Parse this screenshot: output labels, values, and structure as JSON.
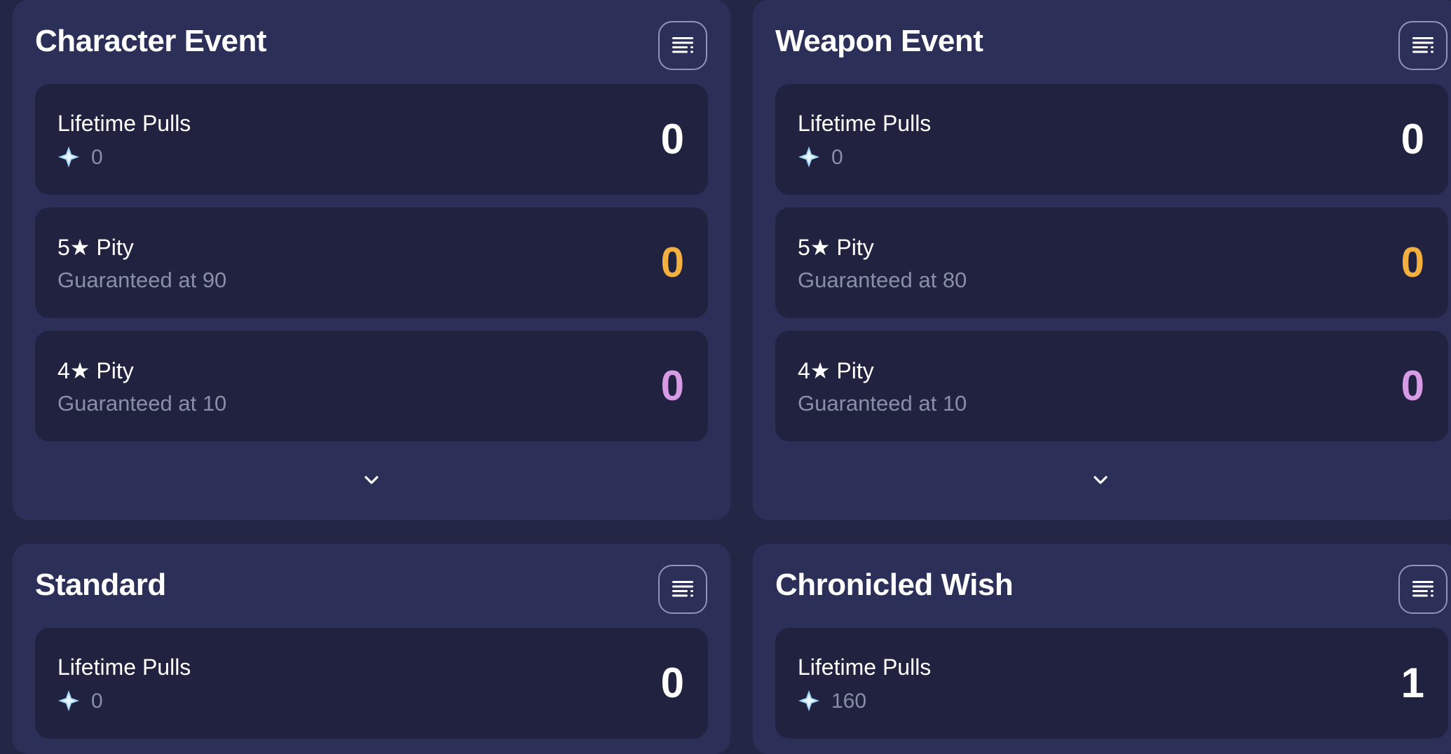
{
  "banners": [
    {
      "title": "Character Event",
      "lifetime_label": "Lifetime Pulls",
      "lifetime_value": "0",
      "primogems": "0",
      "five_star_label": "5★ Pity",
      "five_star_guarantee": "Guaranteed at 90",
      "five_star_value": "0",
      "four_star_label": "4★ Pity",
      "four_star_guarantee": "Guaranteed at 10",
      "four_star_value": "0"
    },
    {
      "title": "Weapon Event",
      "lifetime_label": "Lifetime Pulls",
      "lifetime_value": "0",
      "primogems": "0",
      "five_star_label": "5★ Pity",
      "five_star_guarantee": "Guaranteed at 80",
      "five_star_value": "0",
      "four_star_label": "4★ Pity",
      "four_star_guarantee": "Guaranteed at 10",
      "four_star_value": "0"
    },
    {
      "title": "Standard",
      "lifetime_label": "Lifetime Pulls",
      "lifetime_value": "0",
      "primogems": "0"
    },
    {
      "title": "Chronicled Wish",
      "lifetime_label": "Lifetime Pulls",
      "lifetime_value": "1",
      "primogems": "160"
    }
  ],
  "icons": {
    "menu": "list-menu-icon",
    "primogem": "primogem-icon",
    "expand": "chevron-down-icon"
  },
  "colors": {
    "background": "#232645",
    "panel": "#2c3058",
    "card": "#202240",
    "five_star": "#f4b03f",
    "four_star": "#d79be6",
    "muted_text": "#8a8fa8"
  }
}
